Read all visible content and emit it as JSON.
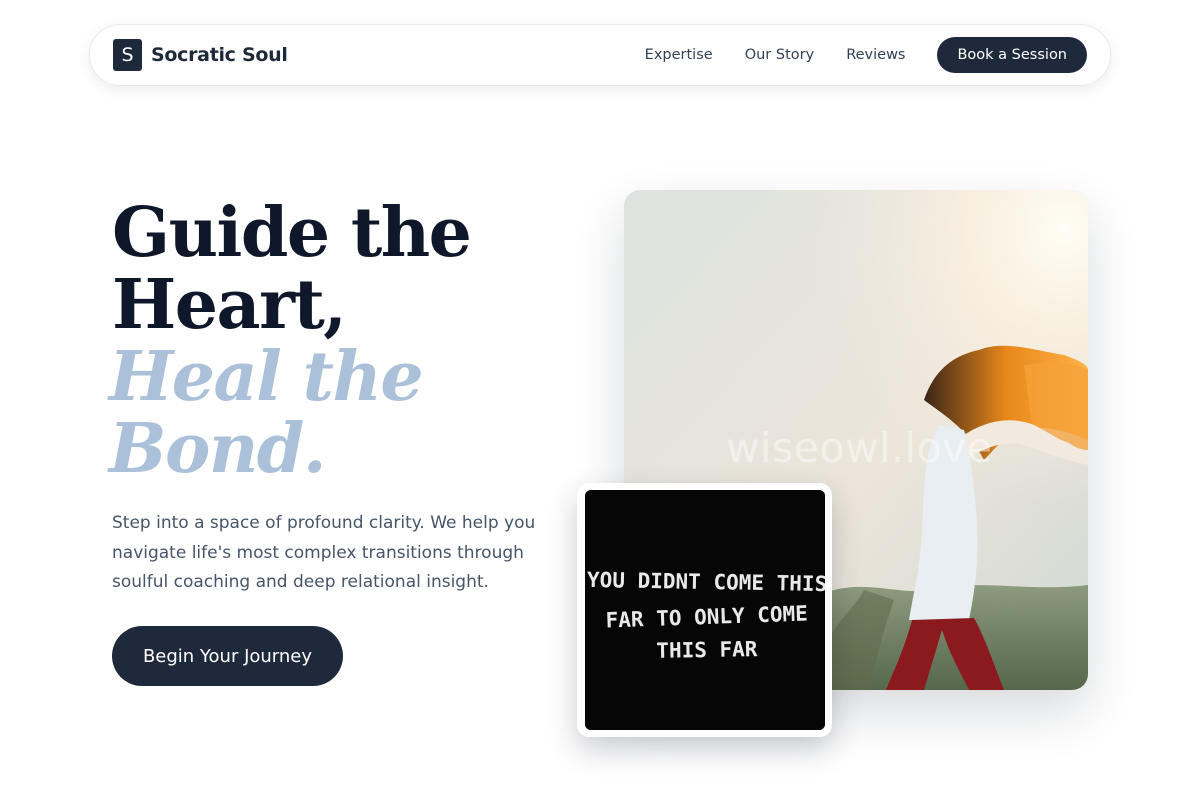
{
  "brand": {
    "mark": "S",
    "name": "Socratic Soul"
  },
  "nav": {
    "links": [
      "Expertise",
      "Our Story",
      "Reviews"
    ],
    "cta_label": "Book a Session"
  },
  "hero": {
    "headline_line1": "Guide the",
    "headline_line2": "Heart,",
    "headline_accent1": "Heal the",
    "headline_accent2": "Bond.",
    "subtext": "Step into a space of profound clarity. We help you navigate life's most complex transitions through soulful coaching and deep relational insight.",
    "button_label": "Begin Your Journey"
  },
  "photo": {
    "watermark": "wiseowl.love"
  },
  "quote_card": {
    "line1": "YOU DIDNT COME THIS",
    "line2": "FAR TO ONLY COME",
    "line3": "THIS FAR"
  },
  "colors": {
    "primary": "#1e293b",
    "accent": "#abc0d9",
    "heading": "#0f172a",
    "body_text": "#475569"
  }
}
